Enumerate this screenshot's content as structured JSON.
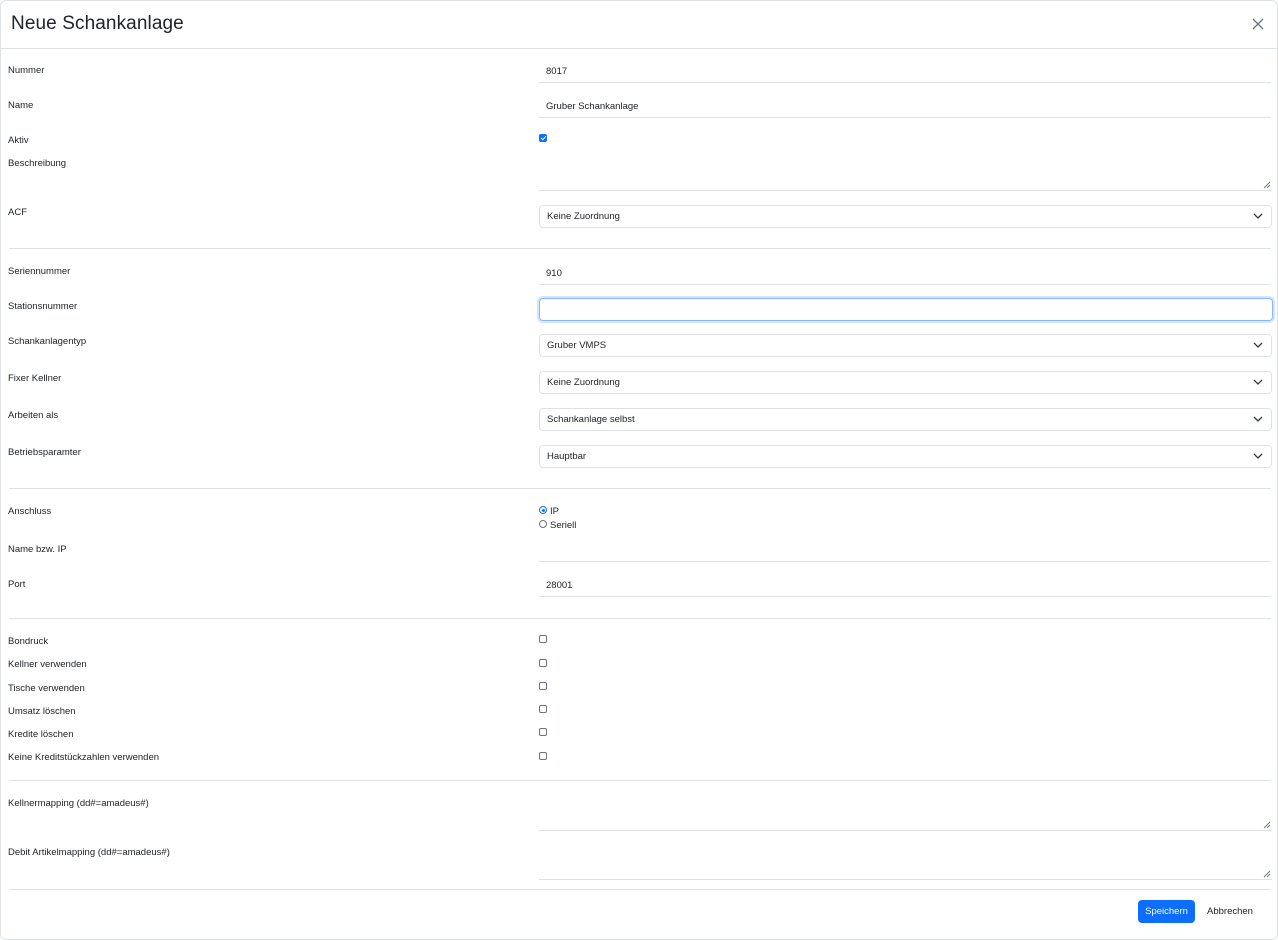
{
  "dialog": {
    "title": "Neue Schankanlage"
  },
  "fields": {
    "nummer": {
      "label": "Nummer",
      "value": "8017"
    },
    "name": {
      "label": "Name",
      "value": "Gruber Schankanlage"
    },
    "aktiv": {
      "label": "Aktiv",
      "checked": true
    },
    "beschreibung": {
      "label": "Beschreibung",
      "value": ""
    },
    "acf": {
      "label": "ACF",
      "value": "Keine Zuordnung"
    },
    "seriennummer": {
      "label": "Seriennummer",
      "value": "910"
    },
    "stationsnummer": {
      "label": "Stationsnummer",
      "value": ""
    },
    "schankanlagentyp": {
      "label": "Schankanlagentyp",
      "value": "Gruber VMPS"
    },
    "fixer_kellner": {
      "label": "Fixer Kellner",
      "value": "Keine Zuordnung"
    },
    "arbeiten_als": {
      "label": "Arbeiten als",
      "value": "Schankanlage selbst"
    },
    "betriebsparamter": {
      "label": "Betriebsparamter",
      "value": "Hauptbar"
    },
    "anschluss": {
      "label": "Anschluss",
      "options": [
        "IP",
        "Seriell"
      ],
      "selected": "IP"
    },
    "name_ip": {
      "label": "Name bzw. IP",
      "value": ""
    },
    "port": {
      "label": "Port",
      "value": "28001"
    },
    "bondruck": {
      "label": "Bondruck",
      "checked": false
    },
    "kellner_verwenden": {
      "label": "Kellner verwenden",
      "checked": false
    },
    "tische_verwenden": {
      "label": "Tische verwenden",
      "checked": false
    },
    "umsatz_loeschen": {
      "label": "Umsatz löschen",
      "checked": false
    },
    "kredite_loeschen": {
      "label": "Kredite löschen",
      "checked": false
    },
    "keine_kreditstueckzahlen": {
      "label": "Keine Kreditstückzahlen verwenden",
      "checked": false
    },
    "kellnermapping": {
      "label": "Kellnermapping (dd#=amadeus#)",
      "value": ""
    },
    "debit_artikelmapping": {
      "label": "Debit Artikelmapping (dd#=amadeus#)",
      "value": ""
    }
  },
  "footer": {
    "save_label": "Speichern",
    "cancel_label": "Abbrechen"
  },
  "colors": {
    "primary": "#0d6efd",
    "border": "#dee2e6",
    "focus_border": "#86b7fe",
    "text": "#212529"
  },
  "icons": {
    "close": "close-icon",
    "dropdown": "chevron-down-icon",
    "resize": "resize-grip-icon"
  }
}
